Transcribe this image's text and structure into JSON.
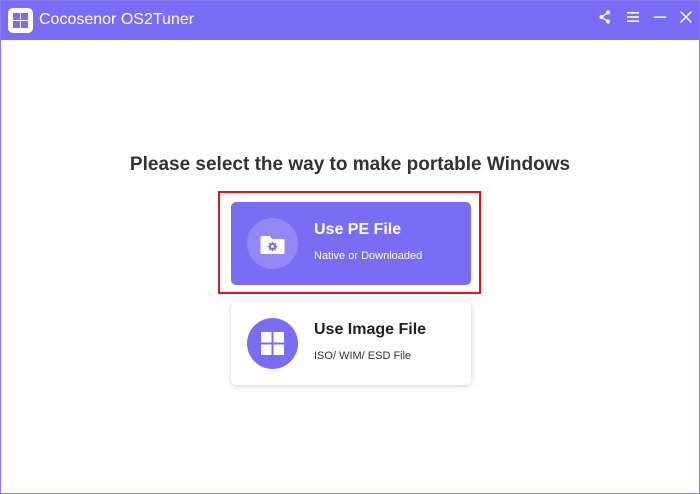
{
  "window": {
    "title": "Cocosenor OS2Tuner",
    "controls": [
      {
        "name": "share-icon"
      },
      {
        "name": "menu-icon"
      },
      {
        "name": "minimize-icon"
      },
      {
        "name": "close-icon"
      }
    ]
  },
  "main": {
    "heading": "Please select the way to make portable Windows",
    "options": [
      {
        "title": "Use PE File",
        "subtitle": "Native or Downloaded",
        "icon": "folder-gear-icon",
        "selected": true
      },
      {
        "title": "Use Image File",
        "subtitle": "ISO/ WIM/ ESD File",
        "icon": "windows-icon",
        "selected": false
      }
    ]
  },
  "colors": {
    "accent": "#7b6cf6",
    "highlight_border": "#e0161b",
    "heading_text": "#333333"
  }
}
